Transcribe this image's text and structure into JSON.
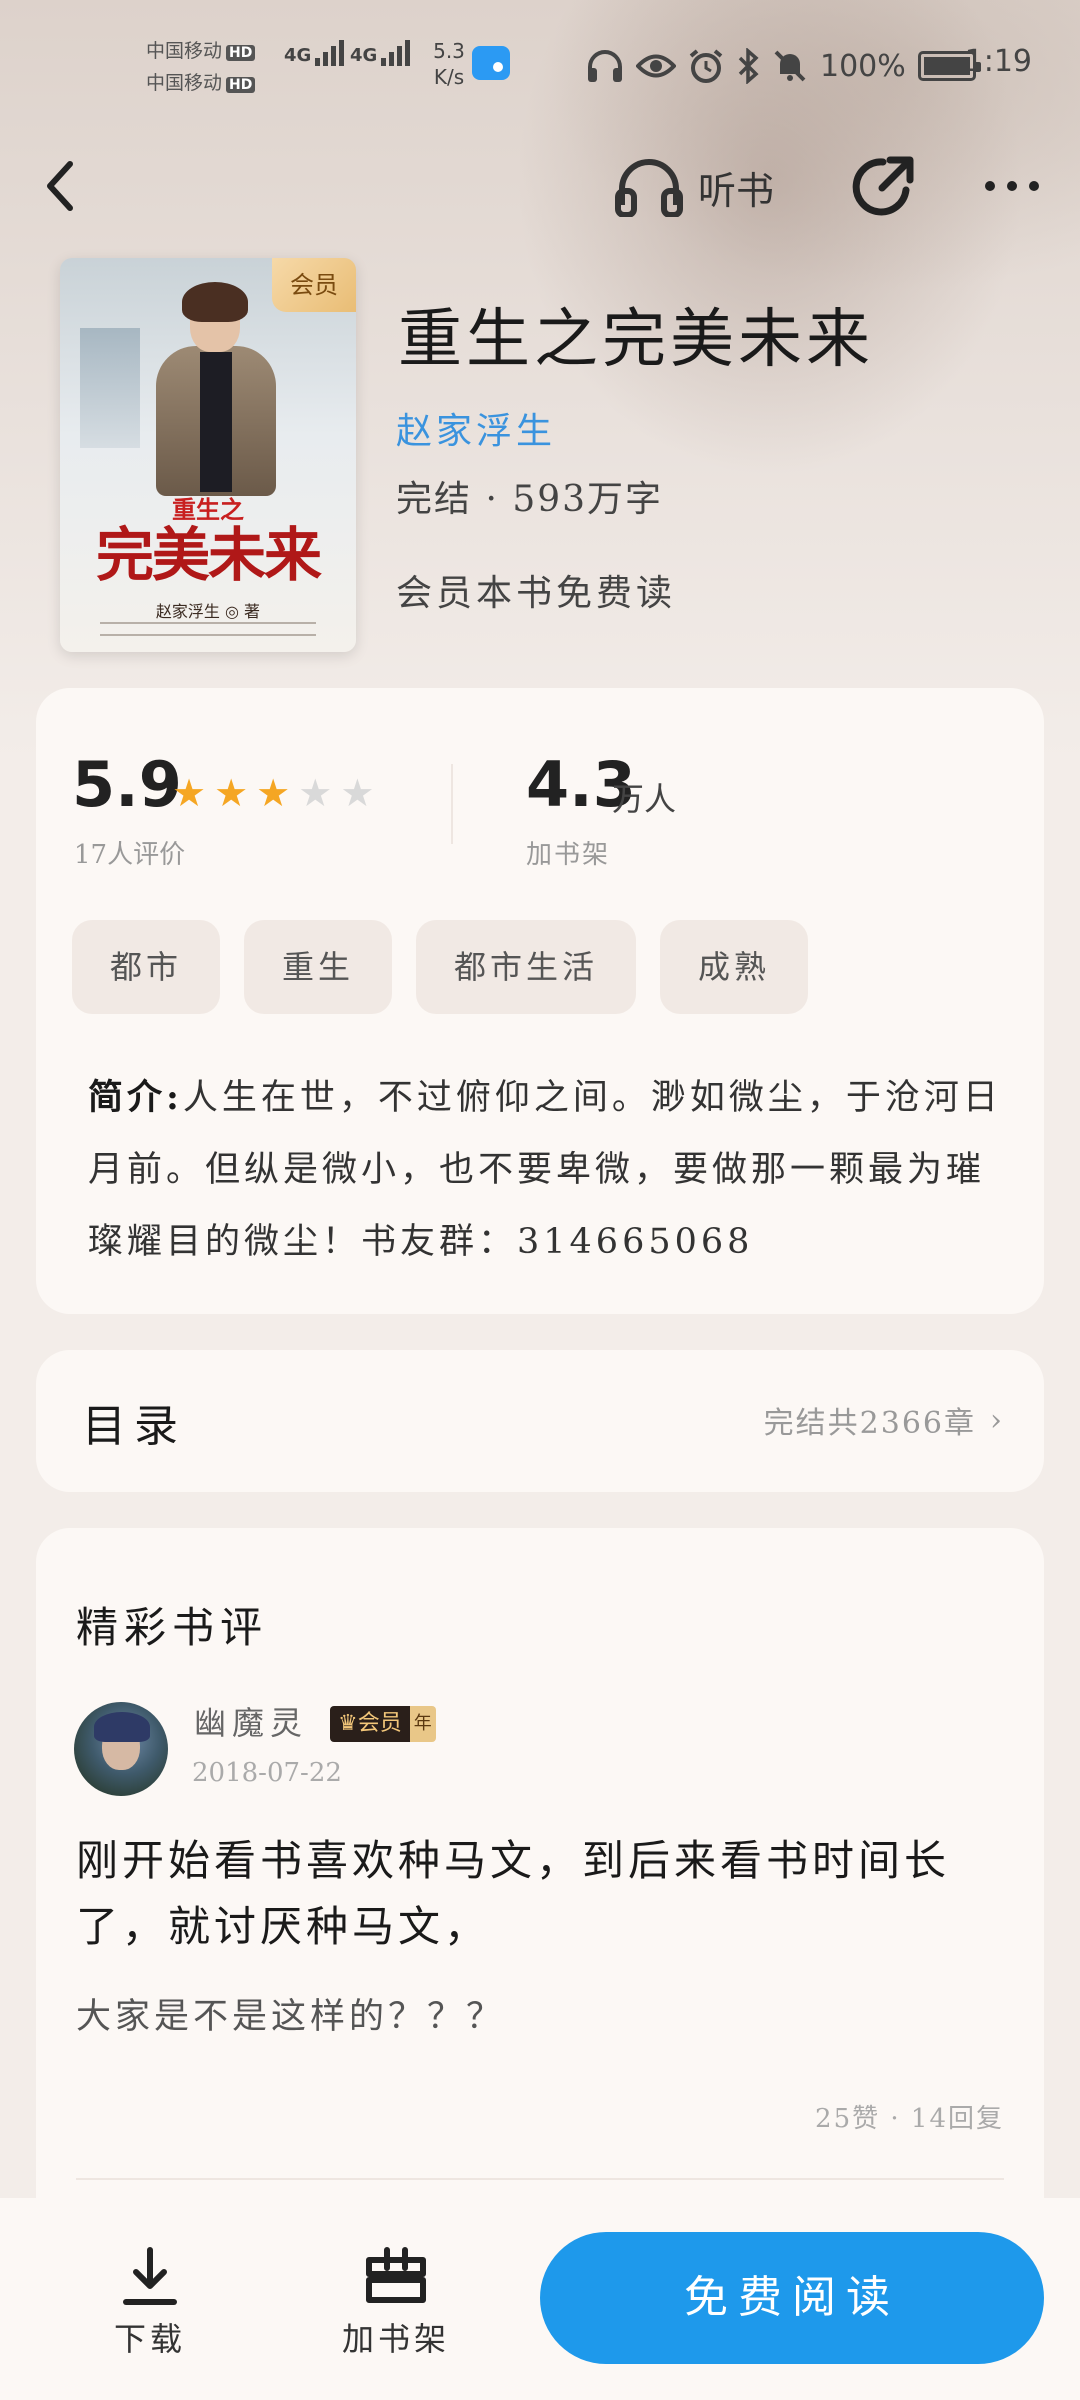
{
  "status_bar": {
    "carrier_1": "中国移动",
    "carrier_2": "中国移动",
    "hd": "HD",
    "network_1": "4G",
    "network_2": "4G",
    "net_speed": "5.3",
    "net_speed_unit": "K/s",
    "battery_percent": "100%",
    "time": "1:19",
    "icons": [
      "headphones-icon",
      "eye-icon",
      "alarm-icon",
      "bluetooth-icon",
      "mute-bell-icon",
      "battery-icon"
    ]
  },
  "nav": {
    "listen_label": "听书",
    "icons": [
      "back-icon",
      "headphones-icon",
      "share-icon",
      "more-icon"
    ]
  },
  "book": {
    "cover_badge": "会员",
    "cover_subtitle": "重生之",
    "cover_title": "完美未来",
    "cover_author": "赵家浮生 ◎ 著",
    "title": "重生之完美未来",
    "author": "赵家浮生",
    "status": "完结 · 593万字",
    "vip_note": "会员本书免费读"
  },
  "stats": {
    "score": "5.9",
    "stars_filled": 3,
    "stars_total": 5,
    "rating_count": "17人评价",
    "shelf_count": "4.3",
    "shelf_unit": "万人",
    "shelf_label": "加书架"
  },
  "tags": [
    "都市",
    "重生",
    "都市生活",
    "成熟"
  ],
  "synopsis": {
    "label": "简介:",
    "text": "人生在世，不过俯仰之间。渺如微尘，于沧河日月前。但纵是微小，也不要卑微，要做那一颗最为璀璨耀目的微尘！书友群：314665068"
  },
  "toc": {
    "label": "目录",
    "meta": "完结共2366章",
    "chevron": "›"
  },
  "reviews": {
    "heading": "精彩书评",
    "items": [
      {
        "name": "幽魔灵",
        "badge": "会员",
        "badge_year": "年",
        "date": "2018-07-22",
        "title": "刚开始看书喜欢种马文，到后来看书时间长了，就讨厌种马文，",
        "body": "大家是不是这样的？？？",
        "stats": "25赞 · 14回复"
      }
    ]
  },
  "bottom_bar": {
    "download_label": "下载",
    "shelf_label": "加书架",
    "read_label": "免费阅读"
  },
  "colors": {
    "accent": "#1e99eb",
    "author_link": "#3a93de",
    "star_on": "#f5a623",
    "star_off": "#d9d9d9"
  }
}
